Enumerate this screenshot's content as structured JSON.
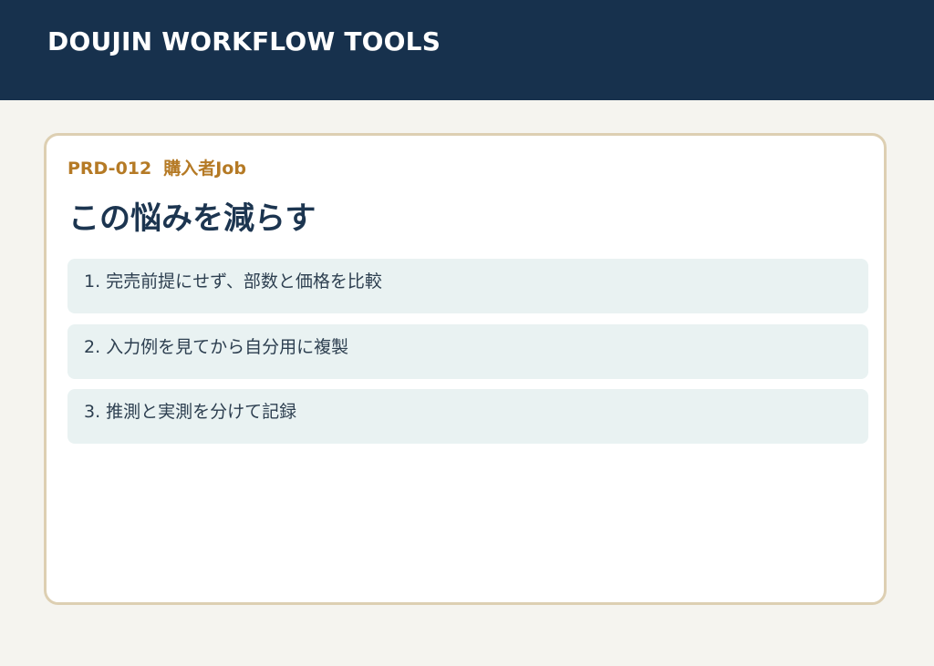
{
  "header": {
    "brand": "DOUJIN WORKFLOW TOOLS"
  },
  "card": {
    "code": "PRD-012",
    "persona": "購入者Job",
    "title": "この悩みを減らす",
    "items": [
      {
        "label": "1. 完売前提にせず、部数と価格を比較"
      },
      {
        "label": "2. 入力例を見てから自分用に複製"
      },
      {
        "label": "3. 推測と実測を分けて記録"
      }
    ]
  },
  "colors": {
    "header_bg": "#17314d",
    "page_bg": "#f5f4ef",
    "accent": "#b57a25",
    "card_border": "#ddcfb2",
    "item_bg": "#e9f2f2",
    "title_text": "#1c3550"
  }
}
